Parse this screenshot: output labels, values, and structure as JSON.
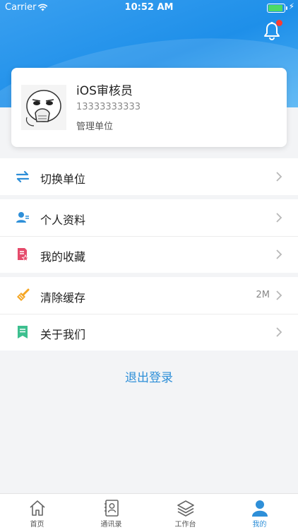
{
  "status_bar": {
    "carrier": "Carrier",
    "time": "10:52 AM"
  },
  "profile": {
    "name": "iOS审核员",
    "phone": "13333333333",
    "organization": "管理单位"
  },
  "menu": {
    "switch_unit": "切换单位",
    "personal_info": "个人资料",
    "favorites": "我的收藏",
    "clear_cache": "清除缓存",
    "cache_size": "2M",
    "about_us": "关于我们"
  },
  "logout_label": "退出登录",
  "tabs": [
    {
      "label": "首页",
      "icon": "home-icon",
      "active": false
    },
    {
      "label": "通讯录",
      "icon": "contacts-icon",
      "active": false
    },
    {
      "label": "工作台",
      "icon": "layers-icon",
      "active": false
    },
    {
      "label": "我的",
      "icon": "person-icon",
      "active": true
    }
  ],
  "colors": {
    "header_blue": "#1e8fe9",
    "accent": "#2e8fd8",
    "notification_dot": "#ff3b30",
    "page_bg": "#f3f4f6"
  },
  "icons": {
    "switch_unit": "swap-arrows-icon",
    "personal_info": "user-card-icon",
    "favorites": "document-star-icon",
    "clear_cache": "broom-icon",
    "about_us": "bookmark-note-icon",
    "notifications": "bell-icon"
  }
}
